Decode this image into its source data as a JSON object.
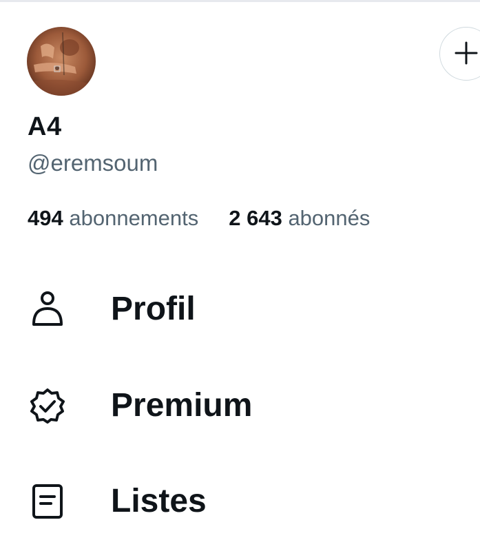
{
  "account": {
    "display_name": "A4",
    "handle": "@eremsoum"
  },
  "stats": {
    "following_count": "494",
    "following_label": "abonnements",
    "followers_count": "2 643",
    "followers_label": "abonnés"
  },
  "menu": {
    "items": [
      {
        "label": "Profil",
        "icon": "person-icon"
      },
      {
        "label": "Premium",
        "icon": "verified-badge-icon"
      },
      {
        "label": "Listes",
        "icon": "list-document-icon"
      }
    ]
  },
  "add_account": {
    "icon": "plus-icon"
  },
  "colors": {
    "text_primary": "#0f1419",
    "text_secondary": "#536471",
    "border": "#cfd9de"
  }
}
